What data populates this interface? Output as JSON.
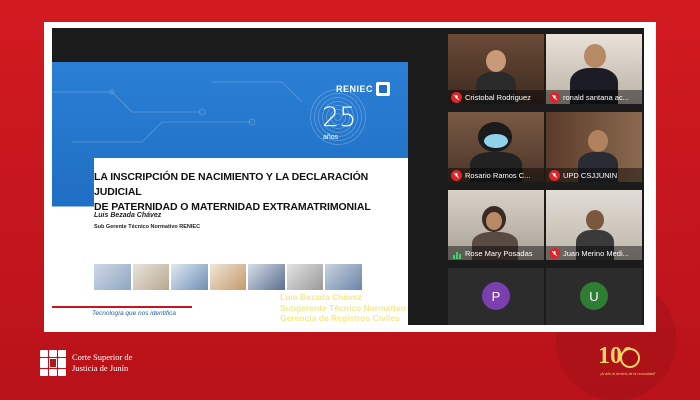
{
  "slide": {
    "logo_text": "RENIEC",
    "anniversary_number": "25",
    "anniversary_word": "años",
    "title_line1": "LA INSCRIPCIÓN DE NACIMIENTO Y LA DECLARACIÓN JUDICIAL",
    "title_line2": "DE PATERNIDAD O MATERNIDAD EXTRAMATRIMONIAL",
    "presenter": "Luis Bezada Chávez",
    "presenter_role": "Sub Gerente Técnico Normativo RENIEC",
    "slogan": "Tecnología que nos identifica"
  },
  "caption": {
    "line1": "Luis Bezada Chávez",
    "line2": "Subgerente Técnico Normativo",
    "line3": "Gerencia de Registros Civiles"
  },
  "participants": [
    {
      "name": "Cristobal Rodriguez",
      "muted": true,
      "avatar": ""
    },
    {
      "name": "ronald santana ac...",
      "muted": true,
      "avatar": ""
    },
    {
      "name": "Rosario Ramos C...",
      "muted": true,
      "avatar": ""
    },
    {
      "name": "UPD CSJJUNIN",
      "muted": true,
      "avatar": ""
    },
    {
      "name": "Rose Mary Posadas",
      "muted": false,
      "avatar": ""
    },
    {
      "name": "Juan Merino Medi...",
      "muted": true,
      "avatar": ""
    },
    {
      "name": "",
      "muted": false,
      "avatar": "P",
      "avatar_color": "#7b3fb0"
    },
    {
      "name": "",
      "muted": false,
      "avatar": "U",
      "avatar_color": "#2e7d32"
    }
  ],
  "branding": {
    "org_line1": "Corte Superior de",
    "org_line2": "Justicia de Junín",
    "centennial": "100",
    "centennial_sub": "¡Al año al servicio de la comunidad!"
  },
  "colors": {
    "background": "#c8151b",
    "slide_blue": "#1f6fc4",
    "caption_yellow": "#f4e98a",
    "muted_red": "#d9262c"
  }
}
